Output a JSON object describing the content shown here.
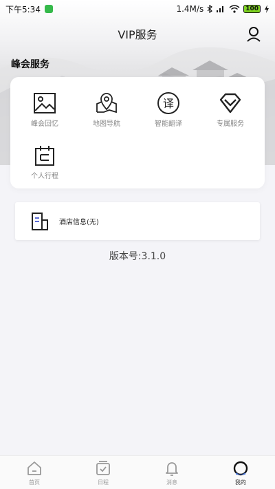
{
  "status_bar": {
    "time": "下午5:34",
    "network_speed": "1.4M/s",
    "battery": "100"
  },
  "header": {
    "title": "VIP服务",
    "user_icon": "user-icon"
  },
  "section": {
    "label": "峰会服务"
  },
  "services": [
    {
      "label": "峰会回忆",
      "icon": "image-icon"
    },
    {
      "label": "地图导航",
      "icon": "map-pin-icon"
    },
    {
      "label": "智能翻译",
      "icon": "translate-icon"
    },
    {
      "label": "专属服务",
      "icon": "diamond-icon"
    },
    {
      "label": "个人行程",
      "icon": "calendar-icon"
    }
  ],
  "hotel": {
    "label": "酒店信息(无)",
    "icon": "building-icon"
  },
  "version": "版本号:3.1.0",
  "tabs": [
    {
      "label": "首页",
      "icon": "home-icon",
      "active": false
    },
    {
      "label": "日程",
      "icon": "schedule-icon",
      "active": false
    },
    {
      "label": "消息",
      "icon": "bell-icon",
      "active": false
    },
    {
      "label": "我的",
      "icon": "profile-icon",
      "active": true
    }
  ]
}
